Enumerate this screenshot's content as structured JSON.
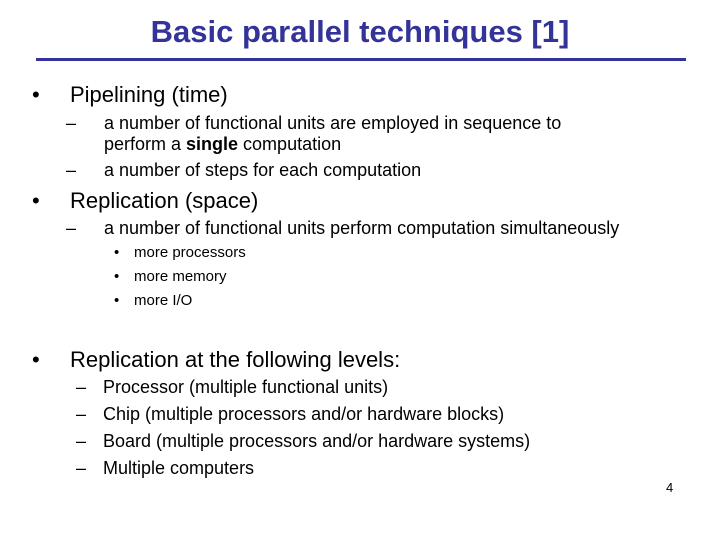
{
  "slide": {
    "title": "Basic parallel techniques [1]",
    "page_number": "4",
    "bullet_glyph": "•",
    "dash_glyph": "–",
    "sections": [
      {
        "heading": "Pipelining (time)",
        "items": [
          {
            "line1": "a number of functional units are employed in sequence to",
            "line2_pre": "perform a ",
            "line2_bold": "single",
            "line2_post": " computation"
          },
          {
            "text": "a number of steps for each computation"
          }
        ]
      },
      {
        "heading": "Replication (space)",
        "items": [
          {
            "text": "a number of functional units perform computation simultaneously"
          }
        ],
        "subitems": [
          "more processors",
          "more memory",
          "more I/O"
        ]
      },
      {
        "heading": "Replication at the following levels:",
        "items": [
          {
            "text": "Processor (multiple functional units)"
          },
          {
            "text": "Chip (multiple processors and/or hardware blocks)"
          },
          {
            "text": "Board (multiple processors and/or hardware systems)"
          },
          {
            "text": "Multiple computers"
          }
        ]
      }
    ]
  }
}
